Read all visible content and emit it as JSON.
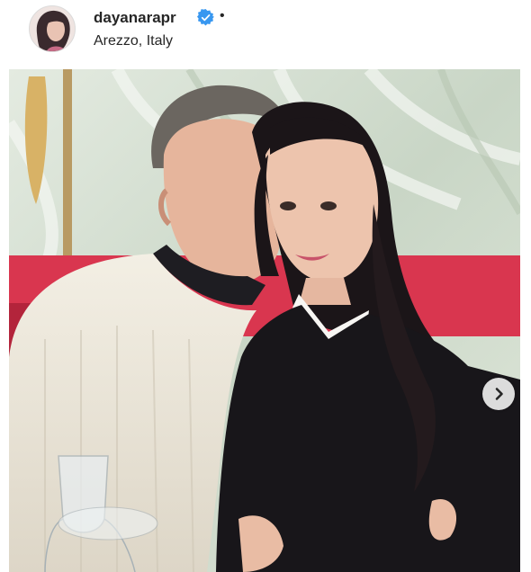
{
  "post": {
    "username": "dayanarapr",
    "separator": "•",
    "location": "Arezzo, Italy",
    "verified": true
  },
  "colors": {
    "verified_badge": "#3897f0",
    "text": "#262626"
  },
  "photo": {
    "description_icon": "carousel-photo"
  },
  "carousel": {
    "next_icon": "chevron-right-icon"
  }
}
